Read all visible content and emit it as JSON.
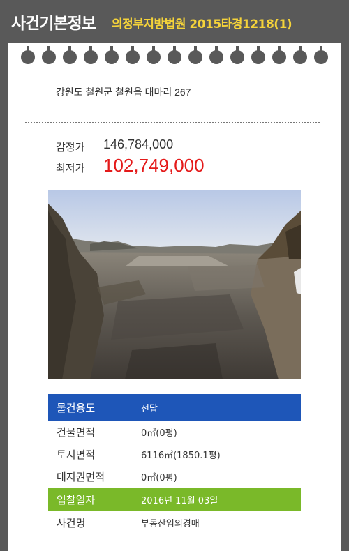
{
  "header": {
    "title": "사건기본정보",
    "case": "의정부지방법원 2015타경1218(1)"
  },
  "colors": {
    "background": "#595959",
    "case_text": "#f5d33a",
    "min_price": "#e41a1a",
    "usage_row": "#1e56b8",
    "bid_date_row": "#7ab929"
  },
  "property": {
    "address": "강원도 철원군 철원읍 대마리 267"
  },
  "prices": {
    "appraisal_label": "감정가",
    "appraisal_value": "146,784,000",
    "minimum_label": "최저가",
    "minimum_value": "102,749,000"
  },
  "photo": {
    "description_icon": "land-photo"
  },
  "details": {
    "usage_label": "물건용도",
    "usage_value": "전답",
    "building_area_label": "건물면적",
    "building_area_value": "0㎡(0평)",
    "land_area_label": "토지면적",
    "land_area_value": "6116㎡(1850.1평)",
    "site_right_area_label": "대지권면적",
    "site_right_area_value": "0㎡(0평)",
    "bid_date_label": "입찰일자",
    "bid_date_value": "2016년 11월 03일",
    "case_name_label": "사건명",
    "case_name_value": "부동산임의경매"
  }
}
